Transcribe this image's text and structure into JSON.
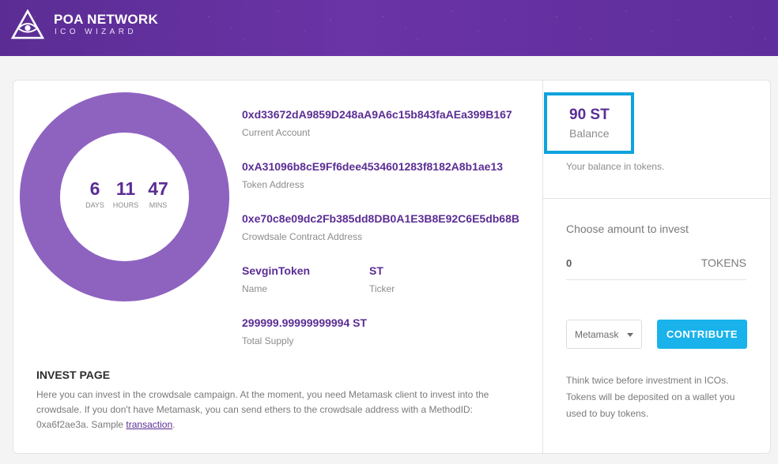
{
  "header": {
    "title": "POA NETWORK",
    "subtitle": "ICO WIZARD"
  },
  "countdown": {
    "days": "6",
    "days_label": "DAYS",
    "hours": "11",
    "hours_label": "HOURS",
    "mins": "47",
    "mins_label": "MINS",
    "ring_color": "#8e63c0"
  },
  "info": {
    "current_account": {
      "value": "0xd33672dA9859D248aA9A6c15b843faAEa399B167",
      "label": "Current Account"
    },
    "token_address": {
      "value": "0xA31096b8cE9Ff6dee4534601283f8182A8b1ae13",
      "label": "Token Address"
    },
    "crowdsale_address": {
      "value": "0xe70c8e09dc2Fb385dd8DB0A1E3B8E92C6E5db68B",
      "label": "Crowdsale Contract Address"
    },
    "name": {
      "value": "SevginToken",
      "label": "Name"
    },
    "ticker": {
      "value": "ST",
      "label": "Ticker"
    },
    "total_supply": {
      "value": "299999.99999999994 ST",
      "label": "Total Supply"
    }
  },
  "invest": {
    "title": "INVEST PAGE",
    "text": "Here you can invest in the crowdsale campaign. At the moment, you need Metamask client to invest into the crowdsale. If you don't have Metamask, you can send ethers to the crowdsale address with a MethodID: 0xa6f2ae3a. Sample ",
    "link": "transaction",
    "text_end": "."
  },
  "sidebar": {
    "balance_value": "90 ST",
    "balance_label": "Balance",
    "balance_note": "Your balance in tokens.",
    "choose_label": "Choose amount to invest",
    "amount_value": "0",
    "amount_unit": "TOKENS",
    "wallet_select": "Metamask",
    "contribute_label": "CONTRIBUTE",
    "warning": "Think twice before investment in ICOs. Tokens will be deposited on a wallet you used to buy tokens."
  },
  "colors": {
    "brand": "#5b2d94",
    "accent": "#19b2eb",
    "highlight_border": "#0ea3dd"
  }
}
